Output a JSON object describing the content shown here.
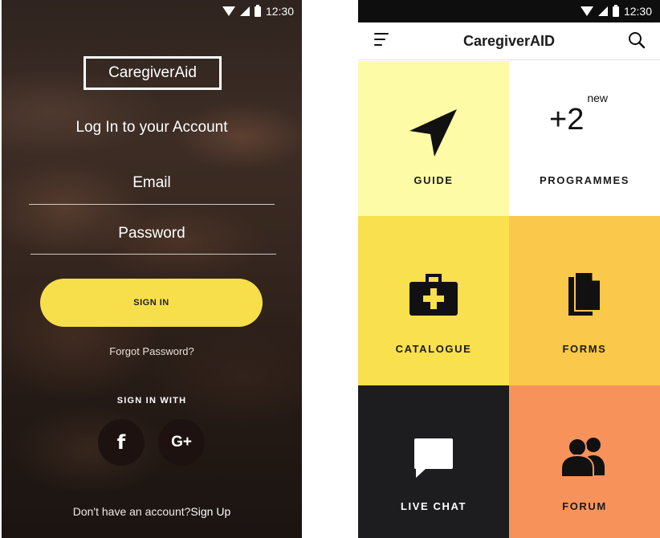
{
  "login_screen": {
    "status_bar": {
      "time": "12:30"
    },
    "logo": "CaregiverAid",
    "heading": "Log In to your Account",
    "email_label": "Email",
    "password_label": "Password",
    "sign_in_button": "SIGN IN",
    "forgot_password": "Forgot Password?",
    "sign_in_with": "SIGN IN WITH",
    "social": {
      "facebook": "f",
      "google_plus": "G+"
    },
    "signup_prompt": "Don't have an account?",
    "signup_link": "Sign Up"
  },
  "dashboard_screen": {
    "status_bar": {
      "time": "12:30"
    },
    "title": "CaregiverAID",
    "tiles": [
      {
        "label": "GUIDE",
        "color": "#fefba6",
        "icon": "navigation-arrow-icon"
      },
      {
        "label": "PROGRAMMES",
        "color": "#ffffff",
        "count": "+2",
        "count_suffix": "new"
      },
      {
        "label": "CATALOGUE",
        "color": "#f8e04e",
        "icon": "first-aid-kit-icon"
      },
      {
        "label": "FORMS",
        "color": "#fac84a",
        "icon": "documents-icon"
      },
      {
        "label": "LIVE CHAT",
        "color": "#1d1d1f",
        "icon": "chat-bubble-icon"
      },
      {
        "label": "FORUM",
        "color": "#f7935a",
        "icon": "people-icon"
      }
    ]
  }
}
